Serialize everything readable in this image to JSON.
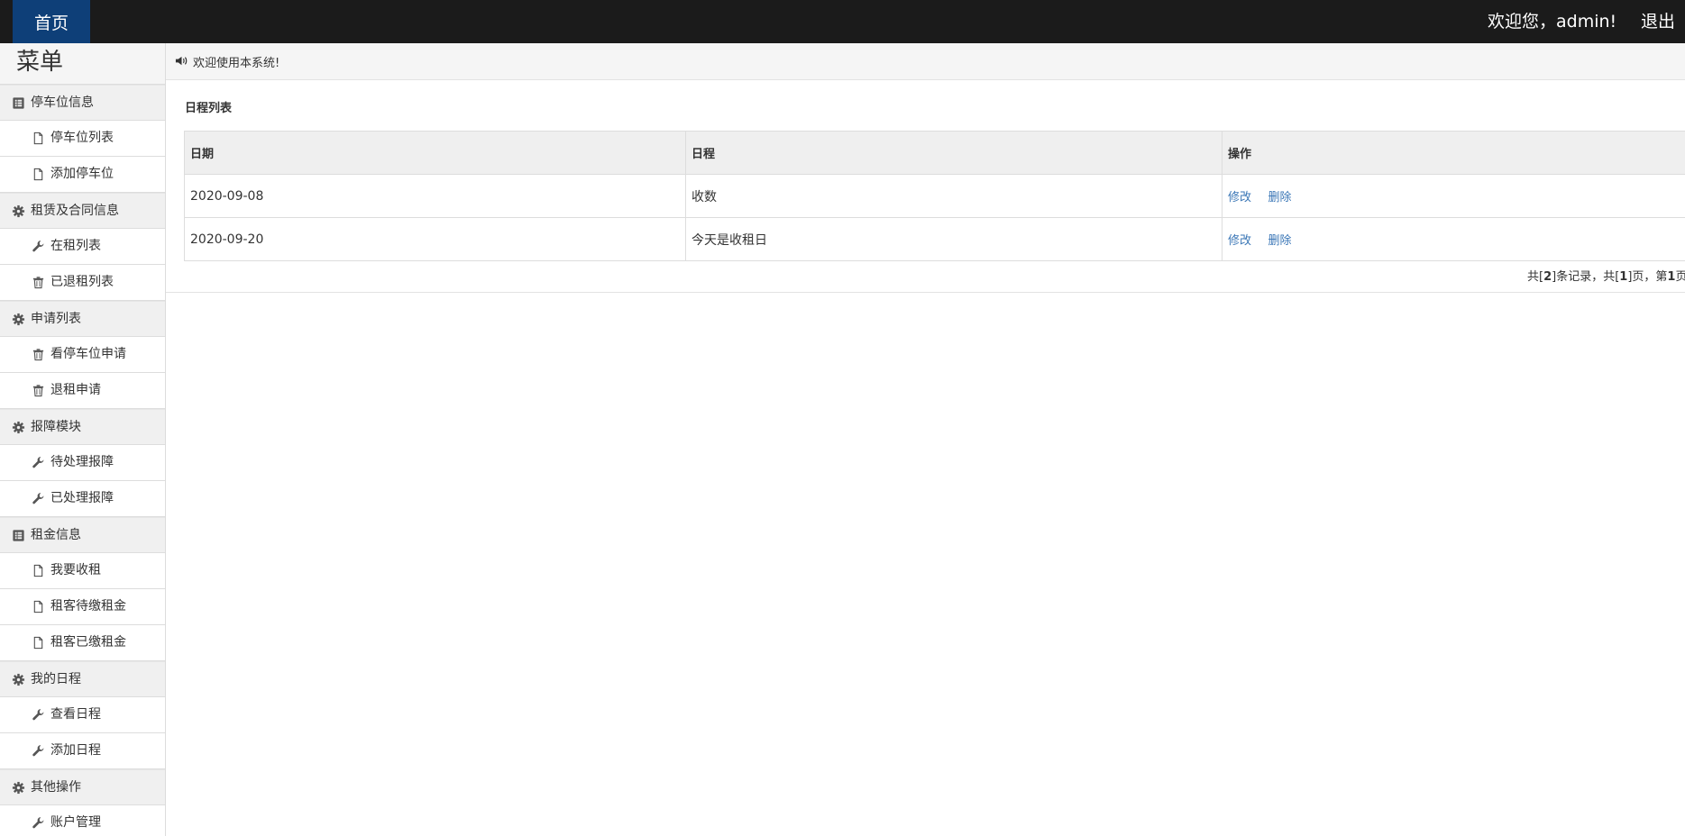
{
  "topbar": {
    "home_label": "首页",
    "welcome_text": "欢迎您，admin!",
    "logout_label": "退出"
  },
  "sidebar": {
    "title": "菜单",
    "groups": [
      {
        "label": "停车位信息",
        "icon": "list-book-icon",
        "items": [
          {
            "label": "停车位列表",
            "icon": "file-icon"
          },
          {
            "label": "添加停车位",
            "icon": "file-icon"
          }
        ]
      },
      {
        "label": "租赁及合同信息",
        "icon": "gear-icon",
        "items": [
          {
            "label": "在租列表",
            "icon": "wrench-icon"
          },
          {
            "label": "已退租列表",
            "icon": "trash-icon"
          }
        ]
      },
      {
        "label": "申请列表",
        "icon": "gear-icon",
        "items": [
          {
            "label": "看停车位申请",
            "icon": "trash-icon"
          },
          {
            "label": "退租申请",
            "icon": "trash-icon"
          }
        ]
      },
      {
        "label": "报障模块",
        "icon": "gear-icon",
        "items": [
          {
            "label": "待处理报障",
            "icon": "wrench-icon"
          },
          {
            "label": "已处理报障",
            "icon": "wrench-icon"
          }
        ]
      },
      {
        "label": "租金信息",
        "icon": "list-book-icon",
        "items": [
          {
            "label": "我要收租",
            "icon": "file-icon"
          },
          {
            "label": "租客待缴租金",
            "icon": "file-icon"
          },
          {
            "label": "租客已缴租金",
            "icon": "file-icon"
          }
        ]
      },
      {
        "label": "我的日程",
        "icon": "gear-icon",
        "items": [
          {
            "label": "查看日程",
            "icon": "wrench-icon"
          },
          {
            "label": "添加日程",
            "icon": "wrench-icon"
          }
        ]
      },
      {
        "label": "其他操作",
        "icon": "gear-icon",
        "items": [
          {
            "label": "账户管理",
            "icon": "wrench-icon"
          }
        ]
      }
    ]
  },
  "notice": {
    "icon": "volume-icon",
    "text": "欢迎使用本系统!"
  },
  "schedule": {
    "title": "日程列表",
    "columns": [
      "日期",
      "日程",
      "操作"
    ],
    "rows": [
      {
        "date": "2020-09-08",
        "event": "收数",
        "edit": "修改",
        "delete": "删除"
      },
      {
        "date": "2020-09-20",
        "event": "今天是收租日",
        "edit": "修改",
        "delete": "删除"
      }
    ],
    "pager": {
      "prefix": "共[",
      "total_records": "2",
      "mid1": "]条记录，共[",
      "total_pages": "1",
      "mid2": "]页，第",
      "current_page": "1",
      "suffix": "页"
    }
  }
}
